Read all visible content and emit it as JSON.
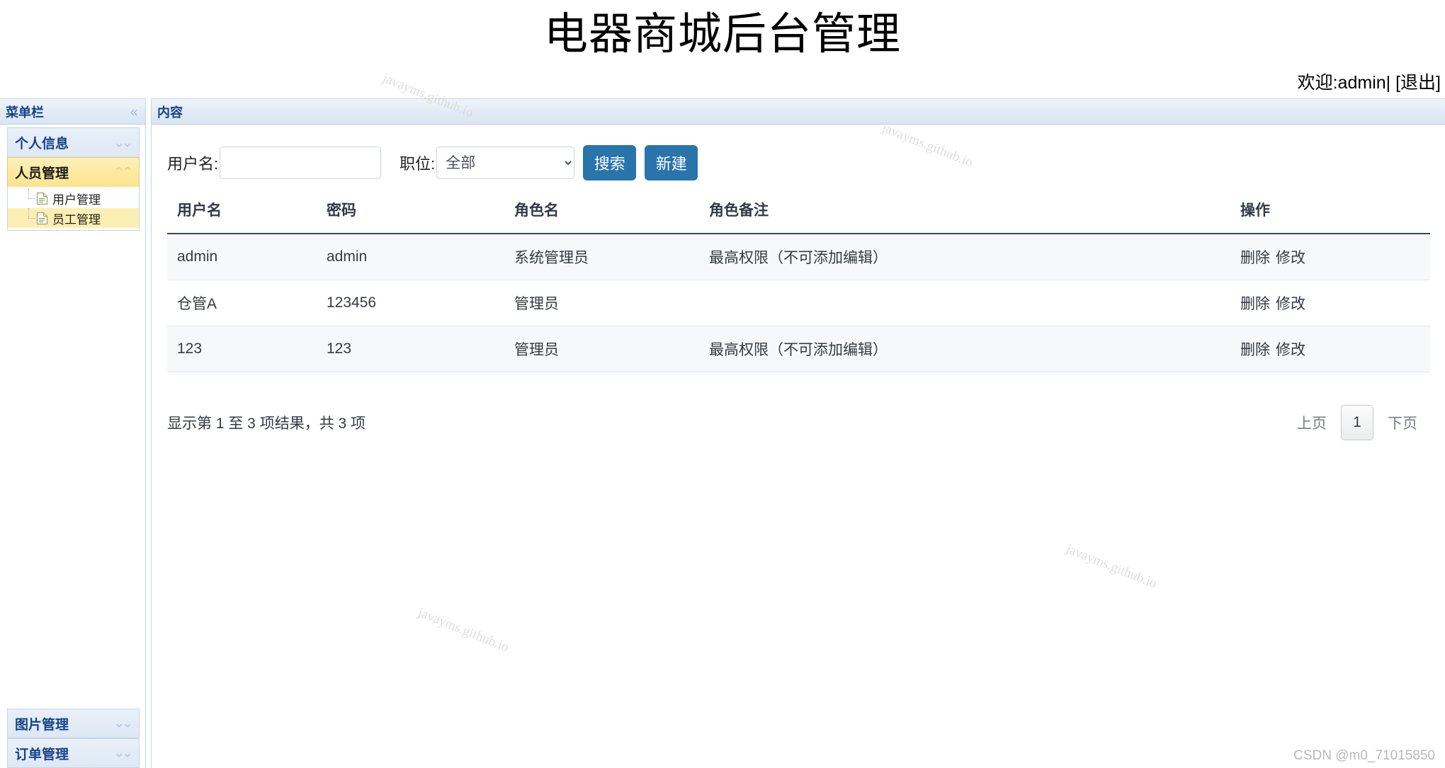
{
  "header": {
    "title": "电器商城后台管理",
    "welcome_text": "欢迎:admin|",
    "logout_label": "[退出]"
  },
  "sidebar": {
    "panel_title": "菜单栏",
    "collapse_icon": "«",
    "groups": [
      {
        "label": "个人信息",
        "expanded": false,
        "chevron": "chevron-down",
        "items": []
      },
      {
        "label": "人员管理",
        "expanded": true,
        "chevron": "chevron-up",
        "items": [
          {
            "label": "用户管理",
            "selected": false
          },
          {
            "label": "员工管理",
            "selected": true
          }
        ]
      }
    ],
    "bottom_groups": [
      {
        "label": "图片管理",
        "expanded": false,
        "chevron": "chevron-down"
      },
      {
        "label": "订单管理",
        "expanded": false,
        "chevron": "chevron-down"
      }
    ]
  },
  "content": {
    "panel_title": "内容",
    "toolbar": {
      "username_label": "用户名:",
      "username_value": "",
      "username_placeholder": "",
      "role_label": "职位:",
      "role_selected": "全部",
      "role_options": [
        "全部"
      ],
      "search_label": "搜索",
      "create_label": "新建"
    },
    "table": {
      "columns": [
        "用户名",
        "密码",
        "角色名",
        "角色备注",
        "操作"
      ],
      "rows": [
        {
          "username": "admin",
          "password": "admin",
          "role": "系统管理员",
          "remark": "最高权限（不可添加编辑）",
          "delete_label": "删除",
          "edit_label": "修改"
        },
        {
          "username": "仓管A",
          "password": "123456",
          "role": "管理员",
          "remark": "",
          "delete_label": "删除",
          "edit_label": "修改"
        },
        {
          "username": "123",
          "password": "123",
          "role": "管理员",
          "remark": "最高权限（不可添加编辑）",
          "delete_label": "删除",
          "edit_label": "修改"
        }
      ]
    },
    "footer": {
      "result_info": "显示第 1 至 3 项结果，共 3 项",
      "prev_label": "上页",
      "current_page": "1",
      "next_label": "下页"
    }
  },
  "watermarks": {
    "site": "javayms.github.io",
    "csdn": "CSDN @m0_71015850"
  },
  "colors": {
    "accent_blue": "#2874ab",
    "panel_header_blue": "#15428b",
    "selected_yellow": "#fdefb3",
    "active_group_yellow": "#fbe48e"
  }
}
